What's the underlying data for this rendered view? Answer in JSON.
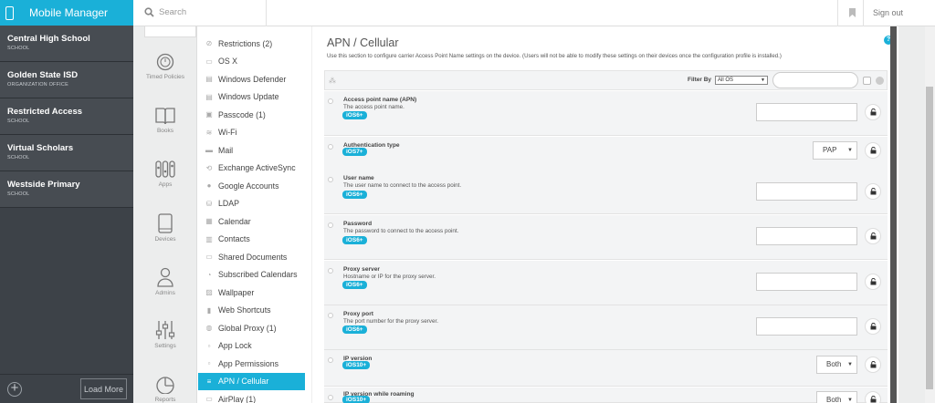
{
  "app": {
    "title": "Mobile Manager"
  },
  "orgs": [
    {
      "name": "Central High School",
      "type": "SCHOOL"
    },
    {
      "name": "Golden State ISD",
      "type": "ORGANIZATION OFFICE"
    },
    {
      "name": "Restricted Access",
      "type": "SCHOOL"
    },
    {
      "name": "Virtual Scholars",
      "type": "SCHOOL"
    },
    {
      "name": "Westside Primary",
      "type": "SCHOOL"
    }
  ],
  "footer": {
    "load_more": "Load More"
  },
  "topbar": {
    "search_placeholder": "Search",
    "sign_out": "Sign out"
  },
  "nav": [
    {
      "label": "Timed Policies",
      "icon": "clock-icon"
    },
    {
      "label": "Books",
      "icon": "book-icon"
    },
    {
      "label": "Apps",
      "icon": "apps-icon"
    },
    {
      "label": "Devices",
      "icon": "tablet-icon"
    },
    {
      "label": "Admins",
      "icon": "person-icon"
    },
    {
      "label": "Settings",
      "icon": "sliders-icon"
    },
    {
      "label": "Reports",
      "icon": "pie-chart-icon"
    }
  ],
  "policies": [
    {
      "label": "Restrictions (2)",
      "icon": "no-entry-icon"
    },
    {
      "label": "OS X",
      "icon": "laptop-icon"
    },
    {
      "label": "Windows Defender",
      "icon": "shield-icon"
    },
    {
      "label": "Windows Update",
      "icon": "windows-icon"
    },
    {
      "label": "Passcode (1)",
      "icon": "lock-icon"
    },
    {
      "label": "Wi-Fi",
      "icon": "wifi-icon"
    },
    {
      "label": "Mail",
      "icon": "mail-icon"
    },
    {
      "label": "Exchange ActiveSync",
      "icon": "sync-icon"
    },
    {
      "label": "Google Accounts",
      "icon": "google-icon"
    },
    {
      "label": "LDAP",
      "icon": "ldap-icon"
    },
    {
      "label": "Calendar",
      "icon": "calendar-icon"
    },
    {
      "label": "Contacts",
      "icon": "contacts-icon"
    },
    {
      "label": "Shared Documents",
      "icon": "documents-icon"
    },
    {
      "label": "Subscribed Calendars",
      "icon": "rss-icon"
    },
    {
      "label": "Wallpaper",
      "icon": "image-icon"
    },
    {
      "label": "Web Shortcuts",
      "icon": "bookmark-icon"
    },
    {
      "label": "Global Proxy (1)",
      "icon": "globe-icon"
    },
    {
      "label": "App Lock",
      "icon": "app-lock-icon"
    },
    {
      "label": "App Permissions",
      "icon": "permissions-icon"
    },
    {
      "label": "APN / Cellular",
      "icon": "cellular-icon"
    },
    {
      "label": "AirPlay (1)",
      "icon": "airplay-icon"
    }
  ],
  "main": {
    "title": "APN / Cellular",
    "description": "Use this section to configure carrier Access Point Name settings on the device. (Users will not be able to modify these settings on their devices once the configuration profile is installed.)",
    "filter_label": "Filter By",
    "filter_value": "All OS",
    "settings": [
      {
        "label": "Access point name (APN)",
        "sub": "The access point name.",
        "badge": "iOS6+",
        "control": "text",
        "value": ""
      },
      {
        "label": "Authentication type",
        "sub": "",
        "badge": "iOS7+",
        "control": "select",
        "value": "PAP"
      },
      {
        "label": "User name",
        "sub": "The user name to connect to the access point.",
        "badge": "iOS6+",
        "control": "text",
        "value": ""
      },
      {
        "label": "Password",
        "sub": "The password to connect to the access point.",
        "badge": "iOS6+",
        "control": "text",
        "value": ""
      },
      {
        "label": "Proxy server",
        "sub": "Hostname or IP for the proxy server.",
        "badge": "iOS6+",
        "control": "text",
        "value": ""
      },
      {
        "label": "Proxy port",
        "sub": "The port number for the proxy server.",
        "badge": "iOS6+",
        "control": "text",
        "value": ""
      },
      {
        "label": "IP version",
        "sub": "",
        "badge": "iOS10+",
        "control": "select",
        "value": "Both"
      },
      {
        "label": "IP version while roaming",
        "sub": "",
        "badge": "iOS10+",
        "control": "select",
        "value": "Both"
      }
    ]
  },
  "colors": {
    "accent": "#1ab0d8",
    "sidebar": "#3d4248"
  }
}
